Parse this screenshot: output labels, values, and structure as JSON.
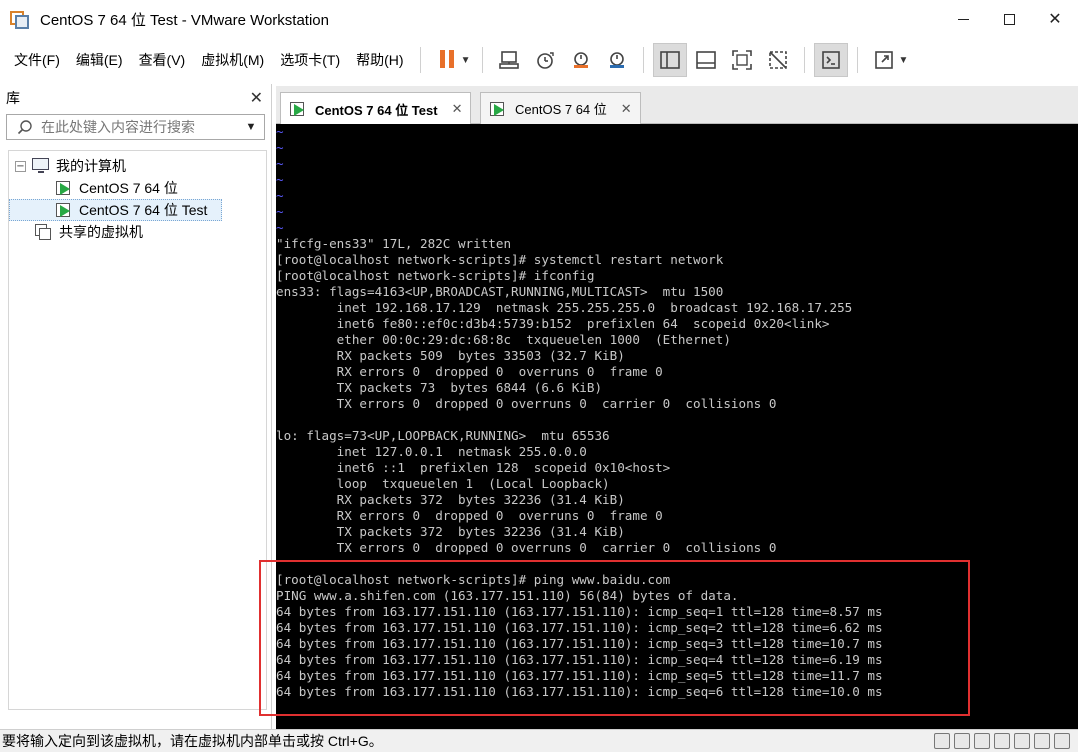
{
  "window": {
    "title": "CentOS 7 64 位 Test - VMware Workstation",
    "controls": {
      "minimize": "",
      "maximize": "",
      "close": "✕"
    }
  },
  "menu": [
    "文件(F)",
    "编辑(E)",
    "查看(V)",
    "虚拟机(M)",
    "选项卡(T)",
    "帮助(H)"
  ],
  "toolbar": {
    "icons": [
      "pause-icon",
      "send-keys-icon",
      "snapshot-icon",
      "revert-snapshot-icon",
      "snapshot-manager-icon",
      "library-view-icon",
      "thumbnail-view-icon",
      "fullscreen-icon",
      "unity-icon",
      "console-view-icon",
      "stretch-icon"
    ],
    "colors": {
      "pause": "#e8702a",
      "accent": "#2b6cb0"
    }
  },
  "library": {
    "title": "库",
    "close": "✕",
    "search_placeholder": "在此处键入内容进行搜索",
    "tree": {
      "root": {
        "expander": "−",
        "label": "我的计算机"
      },
      "vms": [
        "CentOS 7 64 位",
        "CentOS 7 64 位 Test"
      ],
      "shared": "共享的虚拟机"
    }
  },
  "tabs": [
    {
      "label": "CentOS 7 64 位 Test",
      "close": "✕",
      "active": true
    },
    {
      "label": "CentOS 7 64 位",
      "close": "✕",
      "active": false
    }
  ],
  "console": {
    "tilde_lines": [
      "~",
      "~",
      "~",
      "~",
      "~",
      "~",
      "~"
    ],
    "lines": [
      "\"ifcfg-ens33\" 17L, 282C written",
      "[root@localhost network-scripts]# systemctl restart network",
      "[root@localhost network-scripts]# ifconfig",
      "ens33: flags=4163<UP,BROADCAST,RUNNING,MULTICAST>  mtu 1500",
      "        inet 192.168.17.129  netmask 255.255.255.0  broadcast 192.168.17.255",
      "        inet6 fe80::ef0c:d3b4:5739:b152  prefixlen 64  scopeid 0x20<link>",
      "        ether 00:0c:29:dc:68:8c  txqueuelen 1000  (Ethernet)",
      "        RX packets 509  bytes 33503 (32.7 KiB)",
      "        RX errors 0  dropped 0  overruns 0  frame 0",
      "        TX packets 73  bytes 6844 (6.6 KiB)",
      "        TX errors 0  dropped 0 overruns 0  carrier 0  collisions 0",
      "",
      "lo: flags=73<UP,LOOPBACK,RUNNING>  mtu 65536",
      "        inet 127.0.0.1  netmask 255.0.0.0",
      "        inet6 ::1  prefixlen 128  scopeid 0x10<host>",
      "        loop  txqueuelen 1  (Local Loopback)",
      "        RX packets 372  bytes 32236 (31.4 KiB)",
      "        RX errors 0  dropped 0  overruns 0  frame 0",
      "        TX packets 372  bytes 32236 (31.4 KiB)",
      "        TX errors 0  dropped 0 overruns 0  carrier 0  collisions 0",
      "",
      "[root@localhost network-scripts]# ping www.baidu.com",
      "PING www.a.shifen.com (163.177.151.110) 56(84) bytes of data.",
      "64 bytes from 163.177.151.110 (163.177.151.110): icmp_seq=1 ttl=128 time=8.57 ms",
      "64 bytes from 163.177.151.110 (163.177.151.110): icmp_seq=2 ttl=128 time=6.62 ms",
      "64 bytes from 163.177.151.110 (163.177.151.110): icmp_seq=3 ttl=128 time=10.7 ms",
      "64 bytes from 163.177.151.110 (163.177.151.110): icmp_seq=4 ttl=128 time=6.19 ms",
      "64 bytes from 163.177.151.110 (163.177.151.110): icmp_seq=5 ttl=128 time=11.7 ms",
      "64 bytes from 163.177.151.110 (163.177.151.110): icmp_seq=6 ttl=128 time=10.0 ms"
    ],
    "highlight_color": "#e03030"
  },
  "statusbar": {
    "message": "要将输入定向到该虚拟机，请在虚拟机内部单击或按 Ctrl+G。"
  }
}
